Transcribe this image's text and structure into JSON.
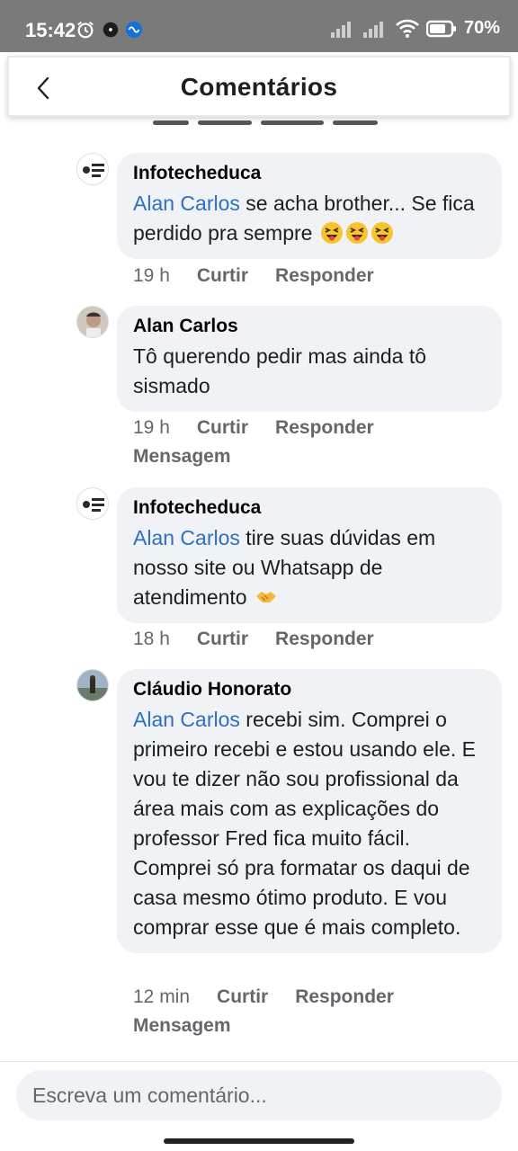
{
  "status_bar": {
    "time": "15:42",
    "battery": "70%",
    "icons": [
      "alarm-icon",
      "notification-dot-icon",
      "app-icon",
      "signal-icon",
      "signal-icon",
      "wifi-icon",
      "battery-icon"
    ]
  },
  "header": {
    "title": "Comentários",
    "back_icon": "chevron-left-icon"
  },
  "comments": [
    {
      "author": "Infotecheduca",
      "mention": "Alan Carlos",
      "text": " se acha brother... Se fica perdido pra sempre",
      "emojis": [
        "squinting-tongue-emoji",
        "squinting-tongue-emoji",
        "squinting-tongue-emoji"
      ],
      "time": "19 h",
      "like": "Curtir",
      "reply": "Responder",
      "avatar_logo": "INFO TECH EDU"
    },
    {
      "author": "Alan Carlos",
      "text": "Tô querendo pedir mas ainda tô sismado",
      "time": "19 h",
      "like": "Curtir",
      "reply": "Responder",
      "message": "Mensagem"
    },
    {
      "author": "Infotecheduca",
      "mention": "Alan Carlos",
      "text": " tire suas dúvidas em nosso site ou Whatsapp de atendimento",
      "emojis": [
        "handshake-emoji"
      ],
      "time": "18 h",
      "like": "Curtir",
      "reply": "Responder",
      "avatar_logo": "INFO TECH EDU"
    },
    {
      "author": "Cláudio Honorato",
      "mention": "Alan Carlos",
      "text": " recebi sim. Comprei o primeiro recebi e estou usando ele. E vou te dizer não sou profissional da área mais com as explicações do professor Fred fica muito fácil. Comprei só pra formatar os daqui de casa mesmo ótimo produto. E vou comprar esse que é mais completo.",
      "time": "12 min",
      "like": "Curtir",
      "reply": "Responder",
      "message": "Mensagem"
    }
  ],
  "input": {
    "placeholder": "Escreva um comentário..."
  },
  "colors": {
    "status_bar": "#7a7a7a",
    "bubble": "#f0f2f5",
    "mention": "#2d6fc2",
    "meta": "#65676b"
  }
}
